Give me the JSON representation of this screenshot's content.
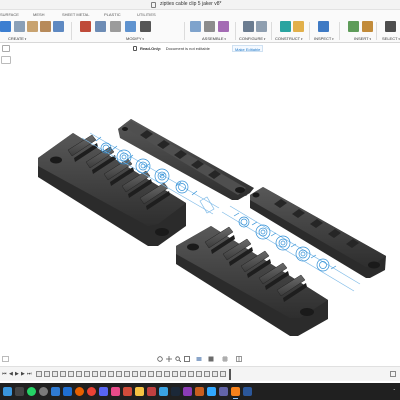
{
  "window": {
    "title": "zipties cable clip 5 jaker v8*"
  },
  "tabs": [
    "SURFACE",
    "MESH",
    "SHEET METAL",
    "PLASTIC",
    "UTILITIES"
  ],
  "toolbar_groups": {
    "create": "CREATE",
    "modify": "MODIFY",
    "assemble": "ASSEMBLE",
    "configure": "CONFIGURE",
    "construct": "CONSTRUCT",
    "inspect": "INSPECT",
    "insert": "INSERT",
    "select": "SELECT"
  },
  "infobar": {
    "read_only": "Read-Only:",
    "not_editable": "Document is not editable",
    "make_editable": "Make Editable"
  },
  "colors": {
    "part_body": "#3a3a3a",
    "part_top": "#4e4e4e",
    "sketch_blue": "#2f8fd6",
    "ribbon_bg": "#fafafa",
    "taskbar_bg": "#202020"
  },
  "icons": {
    "navbar": [
      "orbit-icon",
      "pan-icon",
      "zoom-icon",
      "fit-icon",
      "look-at-icon",
      "display-settings-icon",
      "grid-icon",
      "viewports-icon"
    ],
    "taskbar": [
      "start-icon",
      "search-icon",
      "whatsapp-icon",
      "settings-icon",
      "photos-icon",
      "mail-icon",
      "firefox-icon",
      "chrome-icon",
      "discord-icon",
      "app-icon",
      "gallery-icon",
      "file-explorer-icon",
      "paint-icon",
      "store-icon",
      "steam-icon",
      "game-icon",
      "game-icon",
      "photoshop-icon",
      "teams-icon",
      "fusion-icon",
      "word-icon"
    ]
  }
}
